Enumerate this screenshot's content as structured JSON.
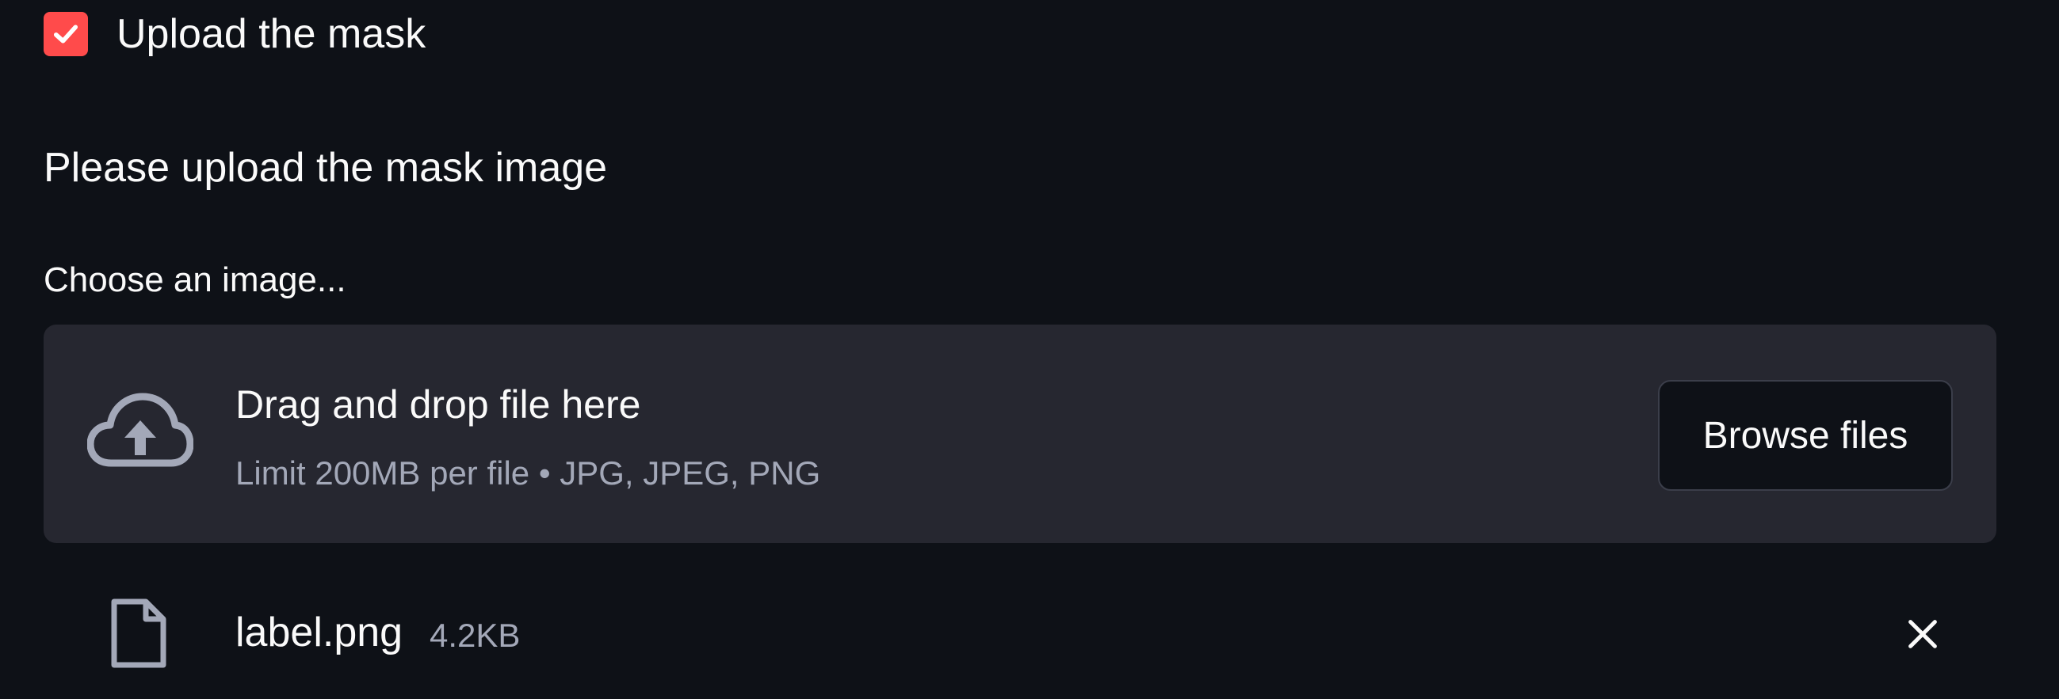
{
  "checkbox": {
    "label": "Upload the mask",
    "checked": true,
    "accent_color": "#ff4b4b"
  },
  "instruction": {
    "text": "Please upload the mask image"
  },
  "uploader": {
    "label": "Choose an image...",
    "dropzone_title": "Drag and drop file here",
    "dropzone_subtitle": "Limit 200MB per file • JPG, JPEG, PNG",
    "browse_label": "Browse files",
    "icon": "cloud-upload-icon"
  },
  "uploaded_file": {
    "name": "label.png",
    "size": "4.2KB",
    "icon": "file-icon",
    "remove_icon": "close-icon"
  },
  "colors": {
    "background": "#0e1117",
    "dropzone": "#262730",
    "muted_text": "#a3a8b8",
    "text": "#fafafa"
  }
}
